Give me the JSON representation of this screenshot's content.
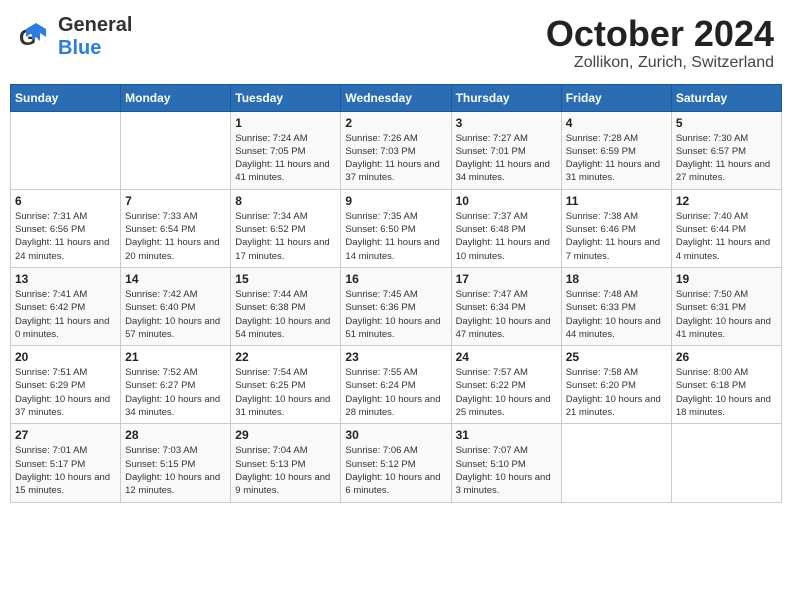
{
  "header": {
    "logo_general": "General",
    "logo_blue": "Blue",
    "month": "October 2024",
    "location": "Zollikon, Zurich, Switzerland"
  },
  "days_of_week": [
    "Sunday",
    "Monday",
    "Tuesday",
    "Wednesday",
    "Thursday",
    "Friday",
    "Saturday"
  ],
  "weeks": [
    [
      {
        "day": "",
        "info": ""
      },
      {
        "day": "",
        "info": ""
      },
      {
        "day": "1",
        "info": "Sunrise: 7:24 AM\nSunset: 7:05 PM\nDaylight: 11 hours and 41 minutes."
      },
      {
        "day": "2",
        "info": "Sunrise: 7:26 AM\nSunset: 7:03 PM\nDaylight: 11 hours and 37 minutes."
      },
      {
        "day": "3",
        "info": "Sunrise: 7:27 AM\nSunset: 7:01 PM\nDaylight: 11 hours and 34 minutes."
      },
      {
        "day": "4",
        "info": "Sunrise: 7:28 AM\nSunset: 6:59 PM\nDaylight: 11 hours and 31 minutes."
      },
      {
        "day": "5",
        "info": "Sunrise: 7:30 AM\nSunset: 6:57 PM\nDaylight: 11 hours and 27 minutes."
      }
    ],
    [
      {
        "day": "6",
        "info": "Sunrise: 7:31 AM\nSunset: 6:56 PM\nDaylight: 11 hours and 24 minutes."
      },
      {
        "day": "7",
        "info": "Sunrise: 7:33 AM\nSunset: 6:54 PM\nDaylight: 11 hours and 20 minutes."
      },
      {
        "day": "8",
        "info": "Sunrise: 7:34 AM\nSunset: 6:52 PM\nDaylight: 11 hours and 17 minutes."
      },
      {
        "day": "9",
        "info": "Sunrise: 7:35 AM\nSunset: 6:50 PM\nDaylight: 11 hours and 14 minutes."
      },
      {
        "day": "10",
        "info": "Sunrise: 7:37 AM\nSunset: 6:48 PM\nDaylight: 11 hours and 10 minutes."
      },
      {
        "day": "11",
        "info": "Sunrise: 7:38 AM\nSunset: 6:46 PM\nDaylight: 11 hours and 7 minutes."
      },
      {
        "day": "12",
        "info": "Sunrise: 7:40 AM\nSunset: 6:44 PM\nDaylight: 11 hours and 4 minutes."
      }
    ],
    [
      {
        "day": "13",
        "info": "Sunrise: 7:41 AM\nSunset: 6:42 PM\nDaylight: 11 hours and 0 minutes."
      },
      {
        "day": "14",
        "info": "Sunrise: 7:42 AM\nSunset: 6:40 PM\nDaylight: 10 hours and 57 minutes."
      },
      {
        "day": "15",
        "info": "Sunrise: 7:44 AM\nSunset: 6:38 PM\nDaylight: 10 hours and 54 minutes."
      },
      {
        "day": "16",
        "info": "Sunrise: 7:45 AM\nSunset: 6:36 PM\nDaylight: 10 hours and 51 minutes."
      },
      {
        "day": "17",
        "info": "Sunrise: 7:47 AM\nSunset: 6:34 PM\nDaylight: 10 hours and 47 minutes."
      },
      {
        "day": "18",
        "info": "Sunrise: 7:48 AM\nSunset: 6:33 PM\nDaylight: 10 hours and 44 minutes."
      },
      {
        "day": "19",
        "info": "Sunrise: 7:50 AM\nSunset: 6:31 PM\nDaylight: 10 hours and 41 minutes."
      }
    ],
    [
      {
        "day": "20",
        "info": "Sunrise: 7:51 AM\nSunset: 6:29 PM\nDaylight: 10 hours and 37 minutes."
      },
      {
        "day": "21",
        "info": "Sunrise: 7:52 AM\nSunset: 6:27 PM\nDaylight: 10 hours and 34 minutes."
      },
      {
        "day": "22",
        "info": "Sunrise: 7:54 AM\nSunset: 6:25 PM\nDaylight: 10 hours and 31 minutes."
      },
      {
        "day": "23",
        "info": "Sunrise: 7:55 AM\nSunset: 6:24 PM\nDaylight: 10 hours and 28 minutes."
      },
      {
        "day": "24",
        "info": "Sunrise: 7:57 AM\nSunset: 6:22 PM\nDaylight: 10 hours and 25 minutes."
      },
      {
        "day": "25",
        "info": "Sunrise: 7:58 AM\nSunset: 6:20 PM\nDaylight: 10 hours and 21 minutes."
      },
      {
        "day": "26",
        "info": "Sunrise: 8:00 AM\nSunset: 6:18 PM\nDaylight: 10 hours and 18 minutes."
      }
    ],
    [
      {
        "day": "27",
        "info": "Sunrise: 7:01 AM\nSunset: 5:17 PM\nDaylight: 10 hours and 15 minutes."
      },
      {
        "day": "28",
        "info": "Sunrise: 7:03 AM\nSunset: 5:15 PM\nDaylight: 10 hours and 12 minutes."
      },
      {
        "day": "29",
        "info": "Sunrise: 7:04 AM\nSunset: 5:13 PM\nDaylight: 10 hours and 9 minutes."
      },
      {
        "day": "30",
        "info": "Sunrise: 7:06 AM\nSunset: 5:12 PM\nDaylight: 10 hours and 6 minutes."
      },
      {
        "day": "31",
        "info": "Sunrise: 7:07 AM\nSunset: 5:10 PM\nDaylight: 10 hours and 3 minutes."
      },
      {
        "day": "",
        "info": ""
      },
      {
        "day": "",
        "info": ""
      }
    ]
  ]
}
